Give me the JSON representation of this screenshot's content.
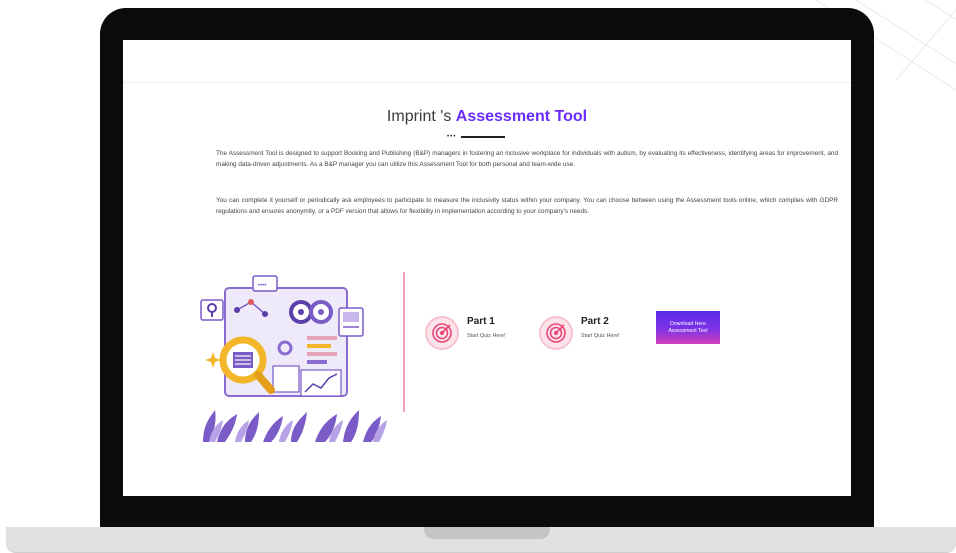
{
  "heading": {
    "prefix": "Imprint 's ",
    "accent": "Assessment Tool"
  },
  "paragraphs": [
    "The Assessment Tool is designed to support Booking and Publishing (B&P) managers in fostering an inclusive workplace for individuals with autism, by evaluating its effectiveness, identifying areas for improvement, and making data-driven adjustments. As a B&P manager you can utilize this Assessment Tool for both personal and team-wide use.",
    "You can complete it yourself or periodically ask employees to participate to measure the inclusivity status within your company. You can choose between using the Assessment tools online, which complies with GDPR regulations and ensures anonymity, or a PDF version that allows for flexibility in implementation according to your company's needs."
  ],
  "quizzes": [
    {
      "title": "Part 1",
      "subtitle": "Start Quiz Here!",
      "icon": "target-icon"
    },
    {
      "title": "Part 2",
      "subtitle": "Start Quiz Here!",
      "icon": "target-icon"
    }
  ],
  "download_button": {
    "label": "Download Here Assessment Tool"
  },
  "illustration": {
    "speech_bubble_text": "••••",
    "icon": "analytics-illustration"
  },
  "colors": {
    "accent_purple": "#6a2cff",
    "divider_pink": "#f0a1b5",
    "target_pink": "#e8477a",
    "illustration_purple": "#8a6bd1",
    "magnifier_gold": "#f3b52a",
    "button_gradient_top": "#5b2ae8",
    "button_gradient_bottom": "#d640b8"
  }
}
